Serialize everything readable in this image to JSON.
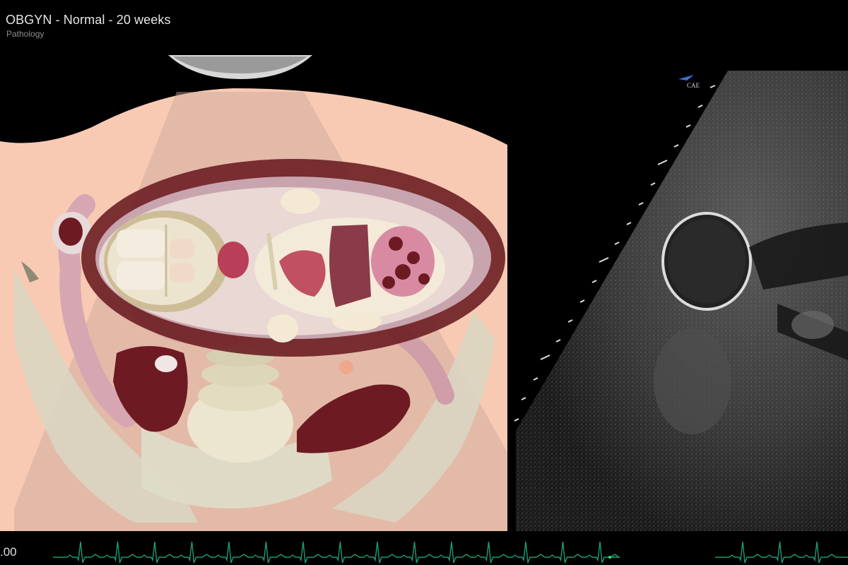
{
  "header": {
    "title": "OBGYN - Normal - 20 weeks",
    "subtitle": "Pathology"
  },
  "ultrasound": {
    "orientation_marker": "CAE"
  },
  "vitals": {
    "value": ".00"
  },
  "colors": {
    "skin": "#f8cab4",
    "beam": "#d9a99a",
    "uterus_wall": "#6b1e22",
    "bone": "#e6dcc2",
    "pelvis": "#d7d4bd",
    "organ_dark": "#6e1a22",
    "ecg_line": "#1f9a78",
    "ecg_marker": "#1cf06a"
  },
  "icons": {
    "probe": "ultrasound-probe-icon",
    "orientation": "orientation-arrow-icon"
  }
}
